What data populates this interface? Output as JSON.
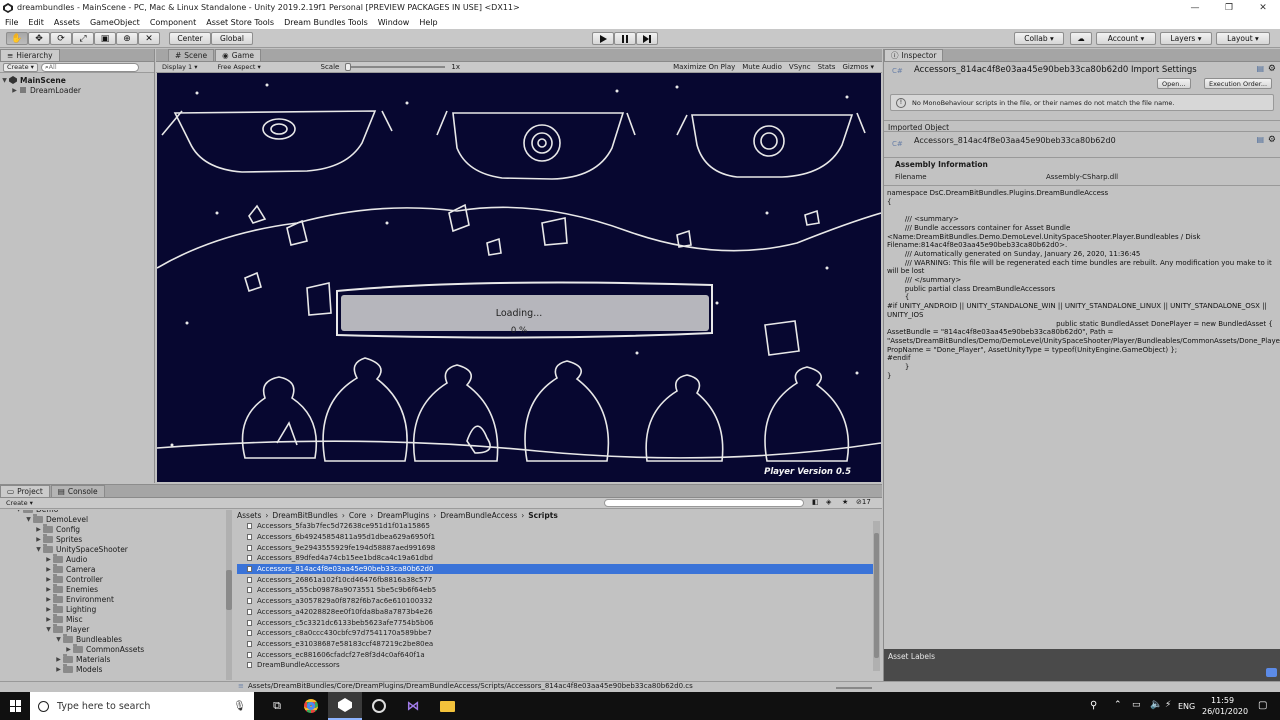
{
  "window": {
    "title": "dreambundles - MainScene - PC, Mac & Linux Standalone - Unity 2019.2.19f1 Personal [PREVIEW PACKAGES IN USE] <DX11>",
    "minimize": "—",
    "maximize": "❐",
    "close": "✕"
  },
  "menu": [
    "File",
    "Edit",
    "Assets",
    "GameObject",
    "Component",
    "Asset Store Tools",
    "Dream Bundles Tools",
    "Window",
    "Help"
  ],
  "toolbar": {
    "center": "Center",
    "global": "Global",
    "collab": "Collab",
    "account": "Account",
    "layers": "Layers",
    "layout": "Layout"
  },
  "hierarchy": {
    "tab": "Hierarchy",
    "create": "Create",
    "search_placeholder": "All",
    "scene": "MainScene",
    "items": [
      "DreamLoader"
    ]
  },
  "game": {
    "tab_scene": "Scene",
    "tab_game": "Game",
    "display": "Display 1",
    "aspect": "Free Aspect",
    "scale_label": "Scale",
    "scale_value": "1x",
    "maximize": "Maximize On Play",
    "mute": "Mute Audio",
    "vsync": "VSync",
    "stats": "Stats",
    "gizmos": "Gizmos",
    "loading_text": "Loading...",
    "progress_text": "0 %",
    "progress": 0,
    "version": "Player Version 0.5"
  },
  "inspector": {
    "tab": "Inspector",
    "title": "Accessors_814ac4f8e03aa45e90beb33ca80b62d0 Import Settings",
    "open": "Open...",
    "exec_order": "Execution Order...",
    "warning": "No MonoBehaviour scripts in the file, or their names do not match the file name.",
    "imported_object": "Imported Object",
    "object_name": "Accessors_814ac4f8e03aa45e90beb33ca80b62d0",
    "assembly_info": "Assembly Information",
    "filename_label": "Filename",
    "filename_value": "Assembly-CSharp.dll",
    "code": "namespace DsC.DreamBitBundles.Plugins.DreamBundleAccess\n{\n\n        /// <summary>\n        /// Bundle accessors container for Asset Bundle <Name:DreamBitBundles.Demo.DemoLevel.UnitySpaceShooter.Player.Bundleables / Disk Filename:814ac4f8e03aa45e90beb33ca80b62d0>.\n        /// Automatically generated on Sunday, January 26, 2020, 11:36:45\n        /// WARNING: This file will be regenerated each time bundles are rebuilt. Any modification you make to it will be lost\n        /// </summary>\n        public partial class DreamBundleAccessors\n        {\n#if UNITY_ANDROID || UNITY_STANDALONE_WIN || UNITY_STANDALONE_LINUX || UNITY_STANDALONE_OSX || UNITY_IOS\n                                                                            public static BundledAsset DonePlayer = new BundledAsset { AssetBundle = \"814ac4f8e03aa45e90beb33ca80b62d0\", Path = \"Assets/DreamBitBundles/Demo/DemoLevel/UnitySpaceShooter/Player/Bundleables/CommonAssets/Done_Player.prefab\", PropName = \"Done_Player\", AssetUnityType = typeof(UnityEngine.GameObject) };\n#endif\n        }\n}",
    "asset_labels": "Asset Labels"
  },
  "project": {
    "tab_project": "Project",
    "tab_console": "Console",
    "create": "Create",
    "breadcrumb": [
      "Assets",
      "DreamBitBundles",
      "Core",
      "DreamPlugins",
      "DreamBundleAccess",
      "Scripts"
    ],
    "count": "17",
    "tree": [
      {
        "label": "Demo",
        "depth": 2,
        "open": true
      },
      {
        "label": "DemoLevel",
        "depth": 3,
        "open": true
      },
      {
        "label": "Config",
        "depth": 4,
        "open": false
      },
      {
        "label": "Sprites",
        "depth": 4,
        "open": false
      },
      {
        "label": "UnitySpaceShooter",
        "depth": 4,
        "open": true
      },
      {
        "label": "Audio",
        "depth": 5,
        "open": false
      },
      {
        "label": "Camera",
        "depth": 5,
        "open": false
      },
      {
        "label": "Controller",
        "depth": 5,
        "open": false
      },
      {
        "label": "Enemies",
        "depth": 5,
        "open": false
      },
      {
        "label": "Environment",
        "depth": 5,
        "open": false
      },
      {
        "label": "Lighting",
        "depth": 5,
        "open": false
      },
      {
        "label": "Misc",
        "depth": 5,
        "open": false
      },
      {
        "label": "Player",
        "depth": 5,
        "open": true
      },
      {
        "label": "Bundleables",
        "depth": 6,
        "open": true
      },
      {
        "label": "CommonAssets",
        "depth": 7,
        "open": false
      },
      {
        "label": "Materials",
        "depth": 6,
        "open": false
      },
      {
        "label": "Models",
        "depth": 6,
        "open": false
      }
    ],
    "files": [
      "Accessors_5fa3b7fec5d72638ce951d1f01a15865",
      "Accessors_6b49245854811a95d1dbea629a6950f1",
      "Accessors_9e2943555929fe194d58887aed991698",
      "Accessors_89dfed4a74cb15ee1bd8ca4c19a61dbd",
      "Accessors_814ac4f8e03aa45e90beb33ca80b62d0",
      "Accessors_26861a102f10cd46476fb8816a38c577",
      "Accessors_a55cb09878a9073551 5be5c9b6f64eb5",
      "Accessors_a3057829a0f8782f6b7ac6e610100332",
      "Accessors_a42028828ee0f10fda8ba8a7873b4e26",
      "Accessors_c5c3321dc6133beb5623afe7754b5b06",
      "Accessors_c8a0ccc430cbfc97d7541170a589bbe7",
      "Accessors_e31038687e58183ccf487219c2be80ea",
      "Accessors_ec881606cfadcf27e8f3d4c0af640f1a",
      "DreamBundleAccessors"
    ],
    "selected_index": 4,
    "status_path": "Assets/DreamBitBundles/Core/DreamPlugins/DreamBundleAccess/Scripts/Accessors_814ac4f8e03aa45e90beb33ca80b62d0.cs"
  },
  "taskbar": {
    "search_placeholder": "Type here to search",
    "language": "ENG",
    "time": "11:59",
    "date": "26/01/2020"
  }
}
